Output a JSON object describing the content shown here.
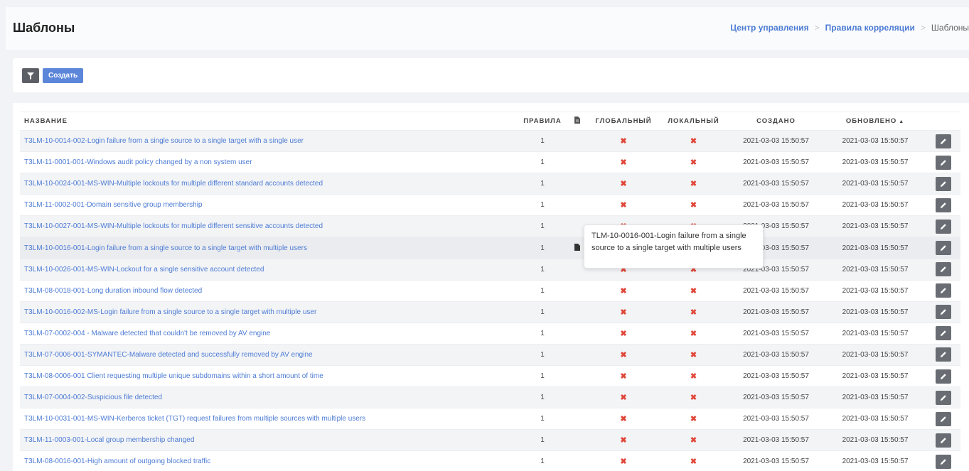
{
  "page": {
    "title": "Шаблоны"
  },
  "breadcrumb": [
    {
      "label": "Центр управления"
    },
    {
      "label": "Правила корреляции"
    },
    {
      "label": "Шаблоны"
    }
  ],
  "toolbar": {
    "create_label": "Создать",
    "filter_icon": "filter-icon"
  },
  "table": {
    "headers": {
      "name": "НАЗВАНИЕ",
      "rules": "ПРАВИЛА",
      "doc_icon": "document-icon",
      "global": "ГЛОБАЛЬНЫЙ",
      "local": "ЛОКАЛЬНЫЙ",
      "created": "СОЗДАНО",
      "updated": "ОБНОВЛЕНО",
      "updated_sort": "▲"
    },
    "rows": [
      {
        "name": "T3LM-10-0014-002-Login failure from a single source to a single target with a single user",
        "rules": "1",
        "doc": false,
        "global": "✖",
        "local": "✖",
        "created": "2021-03-03 15:50:57",
        "updated": "2021-03-03 15:50:57"
      },
      {
        "name": "T3LM-11-0001-001-Windows audit policy changed by a non system user",
        "rules": "1",
        "doc": false,
        "global": "✖",
        "local": "✖",
        "created": "2021-03-03 15:50:57",
        "updated": "2021-03-03 15:50:57"
      },
      {
        "name": "T3LM-10-0024-001-MS-WIN-Multiple lockouts for multiple different standard accounts detected",
        "rules": "1",
        "doc": false,
        "global": "✖",
        "local": "✖",
        "created": "2021-03-03 15:50:57",
        "updated": "2021-03-03 15:50:57"
      },
      {
        "name": "T3LM-11-0002-001-Domain sensitive group membership",
        "rules": "1",
        "doc": false,
        "global": "✖",
        "local": "✖",
        "created": "2021-03-03 15:50:57",
        "updated": "2021-03-03 15:50:57"
      },
      {
        "name": "T3LM-10-0027-001-MS-WIN-Multiple lockouts for multiple different sensitive accounts detected",
        "rules": "1",
        "doc": false,
        "global": "✖",
        "local": "✖",
        "created": "2021-03-03 15:50:57",
        "updated": "2021-03-03 15:50:57"
      },
      {
        "name": "T3LM-10-0016-001-Login failure from a single source to a single target with multiple users",
        "rules": "1",
        "doc": true,
        "global": "✖",
        "local": "✖",
        "created": "2021-03-03 15:50:57",
        "updated": "2021-03-03 15:50:57"
      },
      {
        "name": "T3LM-10-0026-001-MS-WIN-Lockout for a single sensitive account detected",
        "rules": "1",
        "doc": false,
        "global": "✖",
        "local": "✖",
        "created": "2021-03-03 15:50:57",
        "updated": "2021-03-03 15:50:57"
      },
      {
        "name": "T3LM-08-0018-001-Long duration inbound flow detected",
        "rules": "1",
        "doc": false,
        "global": "✖",
        "local": "✖",
        "created": "2021-03-03 15:50:57",
        "updated": "2021-03-03 15:50:57"
      },
      {
        "name": "T3LM-10-0016-002-MS-Login failure from a single source to a single target with multiple user",
        "rules": "1",
        "doc": false,
        "global": "✖",
        "local": "✖",
        "created": "2021-03-03 15:50:57",
        "updated": "2021-03-03 15:50:57"
      },
      {
        "name": "T3LM-07-0002-004 - Malware detected that couldn't be removed by AV engine",
        "rules": "1",
        "doc": false,
        "global": "✖",
        "local": "✖",
        "created": "2021-03-03 15:50:57",
        "updated": "2021-03-03 15:50:57"
      },
      {
        "name": "T3LM-07-0006-001-SYMANTEC-Malware detected and successfully removed by AV engine",
        "rules": "1",
        "doc": false,
        "global": "✖",
        "local": "✖",
        "created": "2021-03-03 15:50:57",
        "updated": "2021-03-03 15:50:57"
      },
      {
        "name": "T3LM-08-0006-001 Client requesting multiple unique subdomains within a short amount of time",
        "rules": "1",
        "doc": false,
        "global": "✖",
        "local": "✖",
        "created": "2021-03-03 15:50:57",
        "updated": "2021-03-03 15:50:57"
      },
      {
        "name": "T3LM-07-0004-002-Suspicious file detected",
        "rules": "1",
        "doc": false,
        "global": "✖",
        "local": "✖",
        "created": "2021-03-03 15:50:57",
        "updated": "2021-03-03 15:50:57"
      },
      {
        "name": "T3LM-10-0031-001-MS-WIN-Kerberos ticket (TGT) request failures from multiple sources with multiple users",
        "rules": "1",
        "doc": false,
        "global": "✖",
        "local": "✖",
        "created": "2021-03-03 15:50:57",
        "updated": "2021-03-03 15:50:57"
      },
      {
        "name": "T3LM-11-0003-001-Local group membership changed",
        "rules": "1",
        "doc": false,
        "global": "✖",
        "local": "✖",
        "created": "2021-03-03 15:50:57",
        "updated": "2021-03-03 15:50:57"
      },
      {
        "name": "T3LM-08-0016-001-High amount of outgoing blocked traffic",
        "rules": "1",
        "doc": false,
        "global": "✖",
        "local": "✖",
        "created": "2021-03-03 15:50:57",
        "updated": "2021-03-03 15:50:57"
      }
    ]
  },
  "tooltip": {
    "text": "TLM-10-0016-001-Login failure from a single source to a single target with multiple users"
  },
  "colors": {
    "link": "#4c7bd4",
    "primary_button": "#5c86d9",
    "dark_button": "#5c6066",
    "cross": "#e0473a"
  }
}
